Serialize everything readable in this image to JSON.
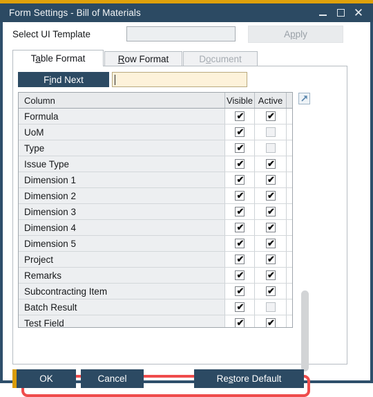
{
  "window": {
    "title": "Form Settings - Bill of Materials",
    "controls": {
      "minimize": "minimize-icon",
      "maximize": "maximize-icon",
      "close": "close-icon"
    },
    "accent_gold": "#dfa10b",
    "titlebar_color": "#2c4a63"
  },
  "toolbar": {
    "template_label": "Select UI Template",
    "template_value": "",
    "template_placeholder": "",
    "apply_label": "Apply",
    "apply_accel": "p",
    "apply_enabled": false
  },
  "tabs": [
    {
      "label": "Table Format",
      "accel": "a",
      "selected": true,
      "enabled": true
    },
    {
      "label": "Row Format",
      "accel": "R",
      "selected": false,
      "enabled": true
    },
    {
      "label": "Document",
      "accel": "o",
      "selected": false,
      "enabled": false
    }
  ],
  "find": {
    "button_label": "Find Next",
    "button_accel": "i",
    "input_value": "",
    "input_placeholder": ""
  },
  "grid": {
    "headers": {
      "column": "Column",
      "visible": "Visible",
      "active": "Active"
    },
    "expand_icon": "diagonal-arrow-icon",
    "rows": [
      {
        "name": "Formula",
        "visible": true,
        "active": true,
        "active_enabled": true
      },
      {
        "name": "UoM",
        "visible": true,
        "active": false,
        "active_enabled": false
      },
      {
        "name": "Type",
        "visible": true,
        "active": false,
        "active_enabled": false
      },
      {
        "name": "Issue Type",
        "visible": true,
        "active": true,
        "active_enabled": true
      },
      {
        "name": "Dimension 1",
        "visible": true,
        "active": true,
        "active_enabled": true
      },
      {
        "name": "Dimension 2",
        "visible": true,
        "active": true,
        "active_enabled": true
      },
      {
        "name": "Dimension 3",
        "visible": true,
        "active": true,
        "active_enabled": true
      },
      {
        "name": "Dimension 4",
        "visible": true,
        "active": true,
        "active_enabled": true
      },
      {
        "name": "Dimension 5",
        "visible": true,
        "active": true,
        "active_enabled": true
      },
      {
        "name": "Project",
        "visible": true,
        "active": true,
        "active_enabled": true
      },
      {
        "name": "Remarks",
        "visible": true,
        "active": true,
        "active_enabled": true
      },
      {
        "name": "Subcontracting Item",
        "visible": true,
        "active": true,
        "active_enabled": true
      },
      {
        "name": "Batch Result",
        "visible": true,
        "active": false,
        "active_enabled": false
      },
      {
        "name": "Test Field",
        "visible": true,
        "active": true,
        "active_enabled": true,
        "highlighted": true
      }
    ],
    "checkmark_glyph": "✔"
  },
  "footer": {
    "ok_label": "OK",
    "cancel_label": "Cancel",
    "restore_label": "Restore Default",
    "restore_accel": "s"
  },
  "annotation": {
    "color": "#ef4c4c",
    "target_row": "Test Field"
  }
}
